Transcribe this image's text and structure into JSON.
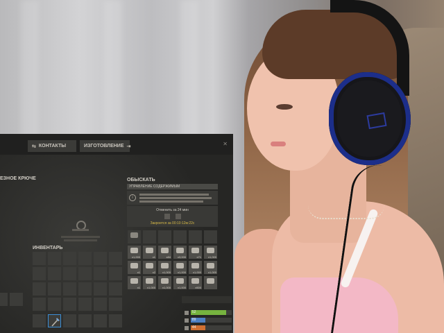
{
  "game": {
    "tabs": [
      {
        "label": "КОНТАКТЫ",
        "icon": "contacts-icon"
      },
      {
        "label": "ИЗГОТОВЛЕНИЕ",
        "icon": "craft-arrow-icon"
      }
    ],
    "hook_title": "ЕЗНОЕ КРЮЧЕ",
    "search": {
      "title": "ОБЫСКАТЬ",
      "panel_header": "УПРАВЛЕНИЕ СОДЕРЖИМЫМ",
      "timer_label": "Отменить за 24 мин",
      "timer_footer": "Закроется за 00:10:12м:22с",
      "items": [
        {
          "qty": "x1,000"
        },
        {
          "qty": "x1"
        },
        {
          "qty": "x84"
        },
        {
          "qty": "x3,000"
        },
        {
          "qty": "x71"
        },
        {
          "qty": "x1,000"
        },
        {
          "qty": "x1"
        },
        {
          "qty": "x2"
        },
        {
          "qty": "x1,000"
        },
        {
          "qty": "x1,000"
        },
        {
          "qty": "x1,000"
        },
        {
          "qty": "x1,000"
        },
        {
          "qty": "x1"
        },
        {
          "qty": "x1,000"
        },
        {
          "qty": "x1,000"
        },
        {
          "qty": "x1,000"
        },
        {
          "qty": "x500"
        },
        {
          "qty": ""
        }
      ]
    },
    "inventory": {
      "title": "ИНВЕНТАРЬ"
    },
    "stats": [
      {
        "text": "52",
        "color": "#76b33f",
        "level": 0.86
      },
      {
        "text": "89",
        "color": "#4d7fc2",
        "level": 0.35
      },
      {
        "text": "44",
        "color": "#d07032",
        "level": 0.35
      }
    ]
  }
}
